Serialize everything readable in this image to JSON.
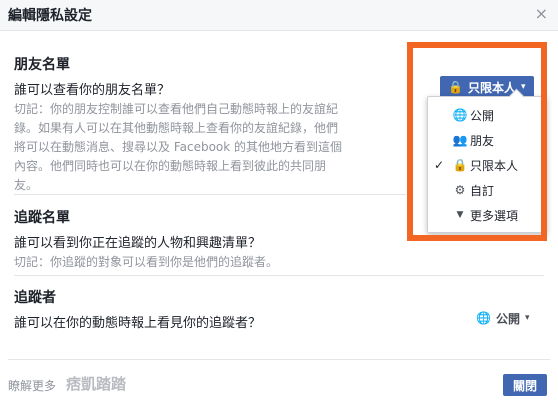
{
  "dialog": {
    "title": "編輯隱私設定",
    "close_glyph": "×"
  },
  "sections": [
    {
      "title": "朋友名單",
      "question": "誰可以查看你的朋友名單？",
      "note_lines": [
        "切記：你的朋友控制誰可以查看他們自己動態時報上的友誼紀",
        "錄。如果有人可以在其他動態時報上查看你的友誼紀錄，他們",
        "將可以在動態消息、搜尋以及 Facebook 的其他地方看到這個",
        "內容。他們同時也可以在你的動態時報上看到彼此的共同朋",
        "友。"
      ],
      "audience": {
        "label": "只限本人",
        "icon": "lock-icon",
        "caret": "▾"
      }
    },
    {
      "title": "追蹤名單",
      "question": "誰可以看到你正在追蹤的人物和興趣清單？",
      "note_lines": [
        "切記：你追蹤的對象可以看到你是他們的追蹤者。"
      ]
    },
    {
      "title": "追蹤者",
      "question": "誰可以在你的動態時報上看見你的追蹤者？",
      "audience": {
        "label": "公開",
        "icon": "globe-icon",
        "caret": "▾"
      }
    }
  ],
  "dropdown": {
    "items": [
      {
        "label": "公開",
        "icon": "globe-icon",
        "glyph": "🌐",
        "checked": false
      },
      {
        "label": "朋友",
        "icon": "friends-icon",
        "glyph": "👥",
        "checked": false
      },
      {
        "label": "只限本人",
        "icon": "lock-icon",
        "glyph": "🔒",
        "checked": true,
        "check_glyph": "✓"
      },
      {
        "label": "自訂",
        "icon": "gear-icon",
        "glyph": "⚙",
        "checked": false
      },
      {
        "label": "更多選項",
        "icon": "caret-down-icon",
        "glyph": "▼",
        "checked": false
      }
    ]
  },
  "footer": {
    "learn_more": "瞭解更多",
    "watermark": "痞凱踏踏",
    "close_label": "關閉"
  },
  "colors": {
    "accent": "#4267b2",
    "highlight": "#f26522",
    "muted": "#90949c"
  }
}
